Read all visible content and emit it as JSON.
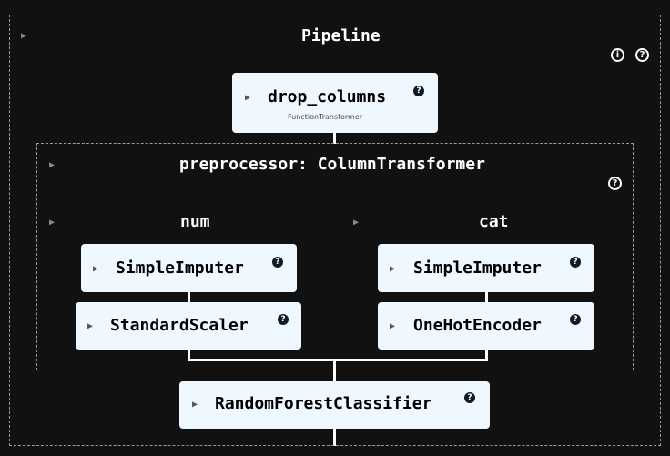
{
  "pipeline": {
    "title": "Pipeline",
    "info_icon": "info-icon",
    "help_icon": "question-icon"
  },
  "drop_columns": {
    "label": "drop_columns",
    "sublabel": "FunctionTransformer"
  },
  "preprocessor": {
    "title": "preprocessor: ColumnTransformer",
    "num": {
      "title": "num",
      "steps": [
        {
          "label": "SimpleImputer"
        },
        {
          "label": "StandardScaler"
        }
      ]
    },
    "cat": {
      "title": "cat",
      "steps": [
        {
          "label": "SimpleImputer"
        },
        {
          "label": "OneHotEncoder"
        }
      ]
    }
  },
  "classifier": {
    "label": "RandomForestClassifier"
  },
  "toggle_glyph": "▶",
  "help_glyph": "?",
  "info_glyph": "i"
}
